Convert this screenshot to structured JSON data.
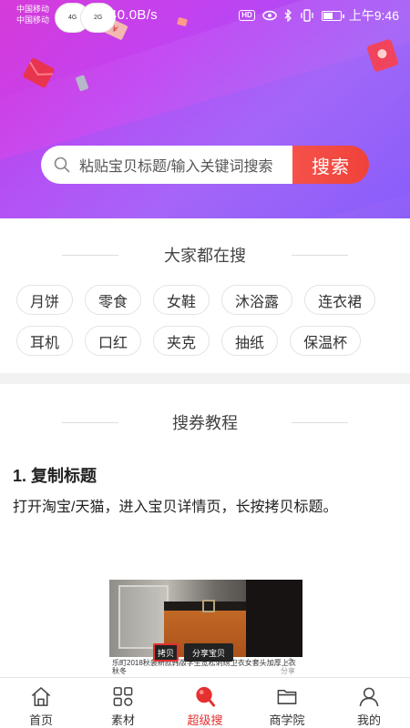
{
  "status_bar": {
    "carrier_1": "中国移动",
    "carrier_2": "中国移动",
    "network_1": "4G",
    "network_2": "2G",
    "speed": "40.0B/s",
    "hd_badge": "HD",
    "time": "上午9:46"
  },
  "search": {
    "placeholder": "粘贴宝贝标题/输入关键词搜索",
    "button_label": "搜索"
  },
  "popular": {
    "title": "大家都在搜",
    "tags": [
      "月饼",
      "零食",
      "女鞋",
      "沐浴露",
      "连衣裙",
      "耳机",
      "口红",
      "夹克",
      "抽纸",
      "保温杯"
    ]
  },
  "tutorial": {
    "title": "搜券教程",
    "step_title": "1. 复制标题",
    "step_desc": "打开淘宝/天猫，进入宝贝详情页，长按拷贝标题。",
    "illustration": {
      "caption": "乐町2018秋装新款韩版学生宽松刺绣卫衣女套头加厚上衣秋冬",
      "copy_label": "拷贝",
      "share_label": "分享宝贝",
      "share_icon_label": "分享"
    }
  },
  "tabbar": {
    "active_color": "#e53030",
    "items": [
      {
        "label": "首页",
        "icon": "home-icon"
      },
      {
        "label": "素材",
        "icon": "grid-icon"
      },
      {
        "label": "超级搜",
        "icon": "super-search-icon"
      },
      {
        "label": "商学院",
        "icon": "folder-icon"
      },
      {
        "label": "我的",
        "icon": "user-icon"
      }
    ]
  },
  "colors": {
    "hero_gradient_start": "#d63ad9",
    "hero_gradient_end": "#8a5cf8",
    "search_button": "#f0423a"
  }
}
